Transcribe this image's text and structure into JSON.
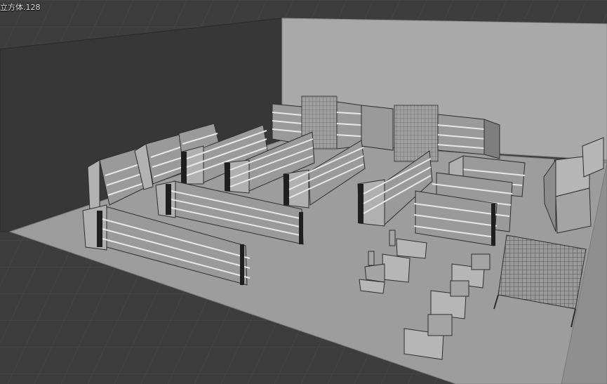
{
  "viewport": {
    "active_object_label": "立方体.128"
  },
  "colors": {
    "background": "#3d3d3d",
    "grid_line": "#4a4a4a",
    "back_wall_dark": "#383838",
    "floor": "#9c9c9c",
    "wall_light": "#a8a8a8",
    "shelf": "#9a9a9a",
    "edge": "#2e2e2e"
  }
}
